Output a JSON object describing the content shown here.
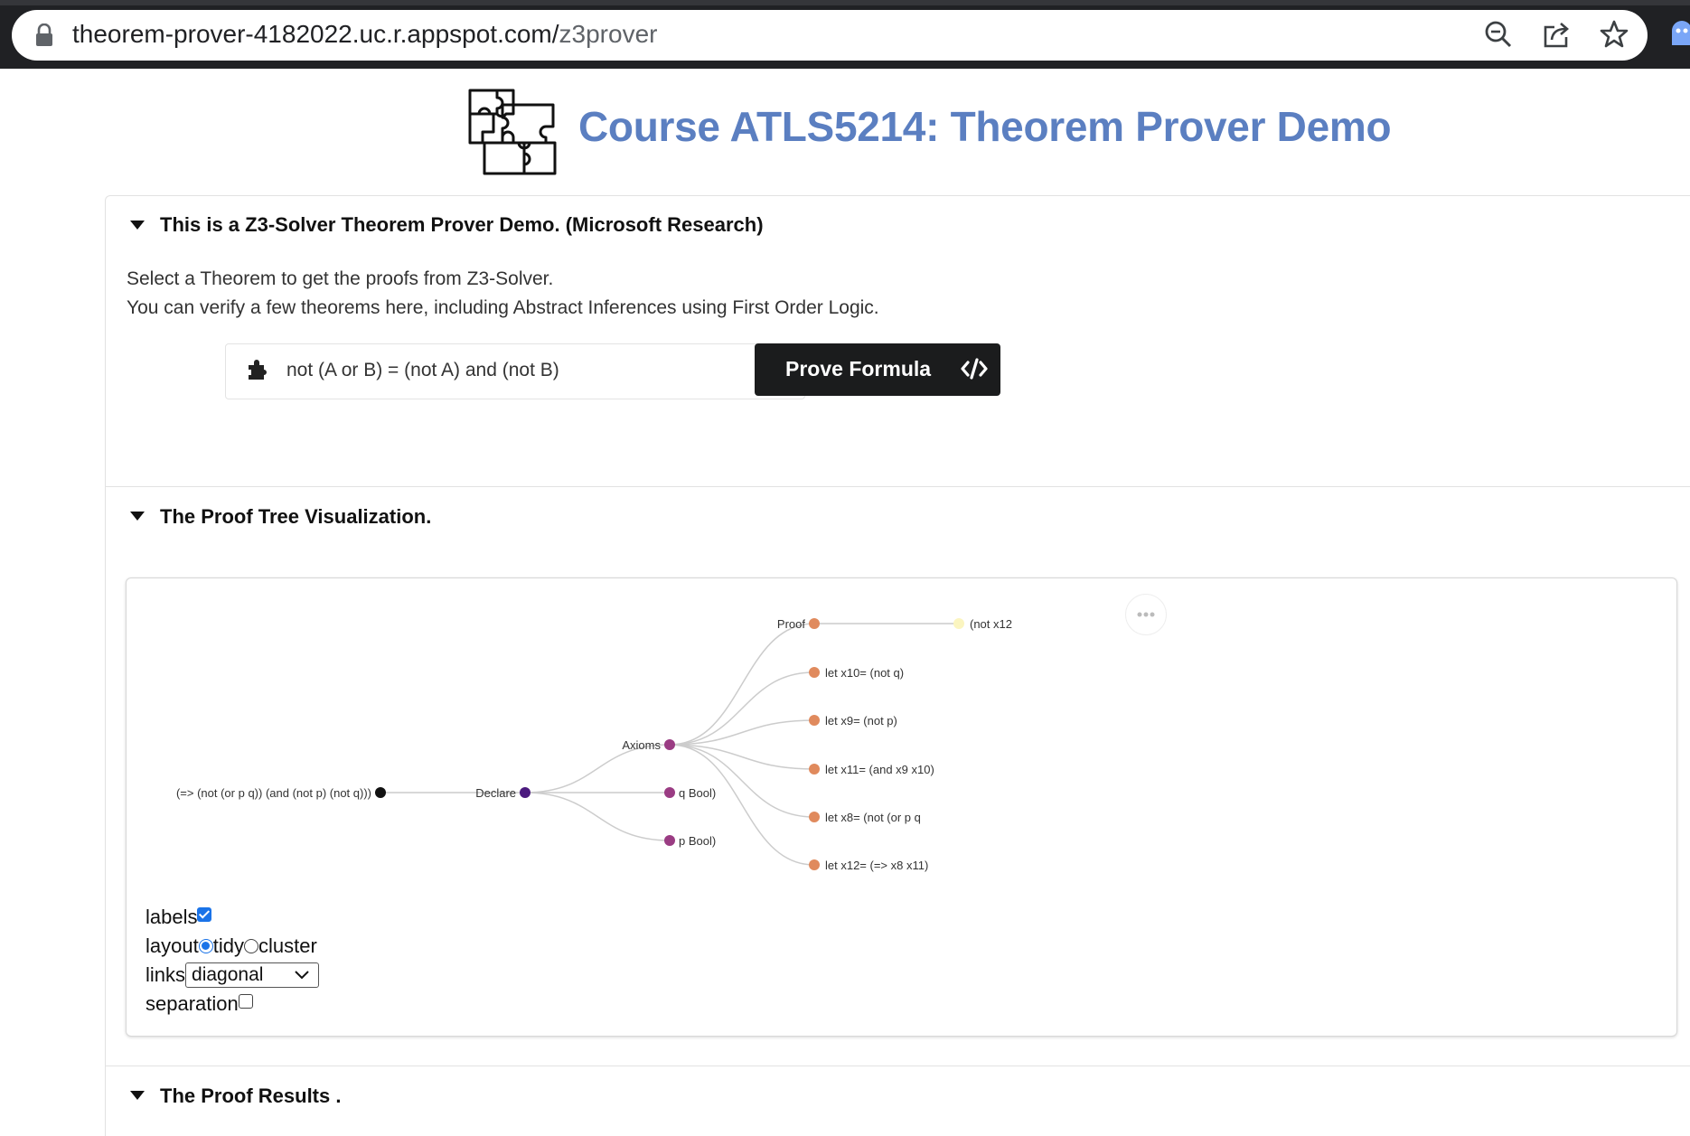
{
  "browser": {
    "url_host": "theorem-prover-4182022.uc.r.appspot.com/",
    "url_path": "z3prover",
    "icons": [
      "lock-icon",
      "zoom-icon",
      "share-icon",
      "bookmark-star-icon",
      "extension-icon"
    ]
  },
  "header": {
    "title": "Course ATLS5214: Theorem Prover Demo",
    "logo": "puzzle-logo-icon"
  },
  "section1": {
    "title": "This is a Z3-Solver Theorem Prover Demo. (Microsoft Research)",
    "line1": "Select a Theorem to get the proofs from Z3-Solver.",
    "line2": "You can verify a few theorems here, including Abstract Inferences using First Order Logic.",
    "formula": "not (A or B) = (not A) and (not B)",
    "prove_button": "Prove Formula"
  },
  "section2": {
    "title": "The Proof Tree Visualization.",
    "tree": {
      "root": "(=> (not (or p q)) (and (not p) (not q)))",
      "declare": "Declare",
      "axioms": "Axioms",
      "q_decl": "q  Bool)",
      "p_decl": "p  Bool)",
      "proof": "Proof",
      "proof_child": "(not x12",
      "let_x10": "let x10= (not q)",
      "let_x9": "let x9= (not p)",
      "let_x11": "let x11= (and x9 x10)",
      "let_x8": "let x8= (not (or p q",
      "let_x12": "let x12= (=> x8 x11)"
    },
    "colors": {
      "root": "#111111",
      "declare": "#4b1a7e",
      "mid": "#9a3c83",
      "leaf": "#e08a5d",
      "deep": "#fbf5c0",
      "link": "#cccccc"
    },
    "controls": {
      "labels": "labels",
      "labels_checked": true,
      "layout": "layout",
      "layout_tidy": "tidy",
      "layout_cluster": "cluster",
      "layout_selected": "tidy",
      "links": "links",
      "links_value": "diagonal",
      "separation": "separation",
      "separation_checked": false
    }
  },
  "section3": {
    "title": "The Proof Results ."
  }
}
